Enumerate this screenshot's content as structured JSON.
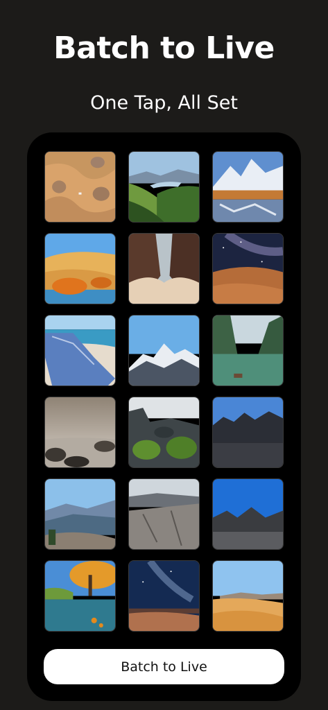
{
  "header": {
    "title": "Batch to Live",
    "subtitle": "One Tap, All Set"
  },
  "gallery": {
    "photos": [
      {
        "name": "desert-aerial"
      },
      {
        "name": "mountain-lake-valley"
      },
      {
        "name": "snowy-peaks-reflection"
      },
      {
        "name": "desert-orange-trees"
      },
      {
        "name": "canyon-dust"
      },
      {
        "name": "milky-way-dunes"
      },
      {
        "name": "beach-towel"
      },
      {
        "name": "snowy-range"
      },
      {
        "name": "river-boat-cliffs"
      },
      {
        "name": "foggy-rocky-shore"
      },
      {
        "name": "mossy-rocks"
      },
      {
        "name": "black-sand-rocks"
      },
      {
        "name": "blue-hills-overlook"
      },
      {
        "name": "cliff-rock-ledge"
      },
      {
        "name": "volcanic-rocks-blue-sky"
      },
      {
        "name": "autumn-lake-tree"
      },
      {
        "name": "night-sky-desert"
      },
      {
        "name": "golden-dunes"
      }
    ]
  },
  "actions": {
    "batch_button_label": "Batch to Live"
  },
  "colors": {
    "background": "#1c1b19",
    "panel": "#000000",
    "button": "#ffffff"
  }
}
